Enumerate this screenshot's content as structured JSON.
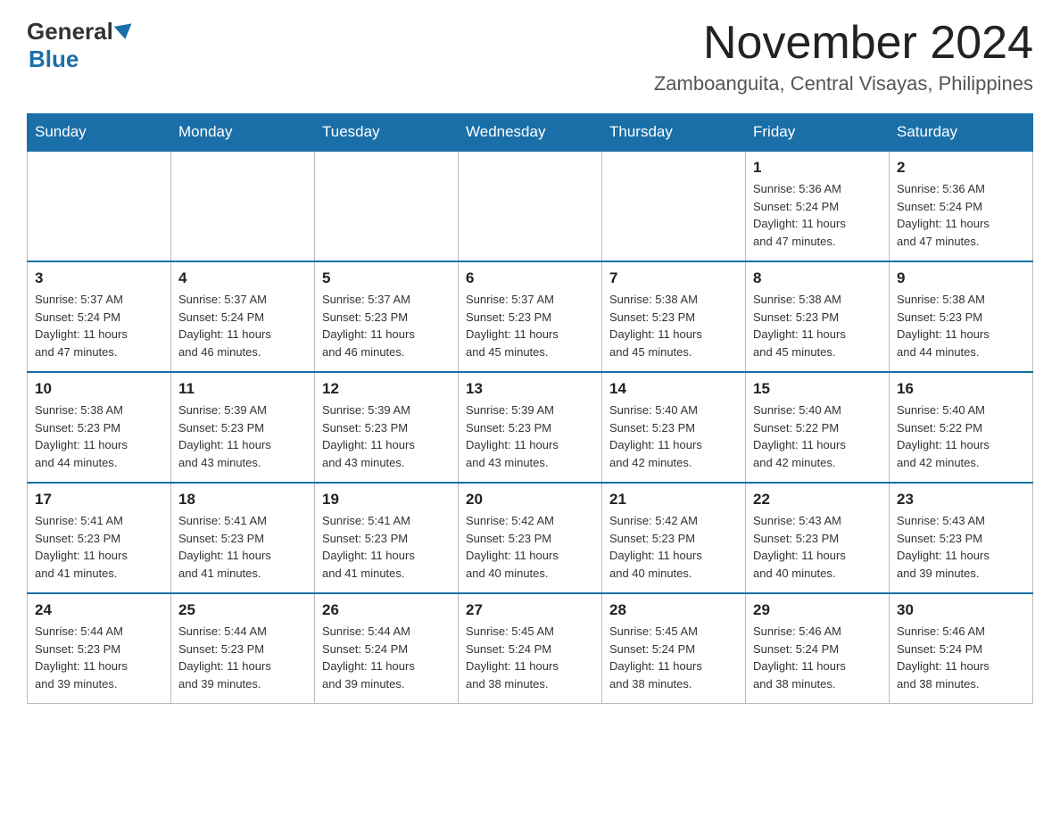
{
  "header": {
    "logo_general": "General",
    "logo_blue": "Blue",
    "month_title": "November 2024",
    "location": "Zamboanguita, Central Visayas, Philippines"
  },
  "days_of_week": [
    "Sunday",
    "Monday",
    "Tuesday",
    "Wednesday",
    "Thursday",
    "Friday",
    "Saturday"
  ],
  "weeks": [
    [
      {
        "day": "",
        "info": ""
      },
      {
        "day": "",
        "info": ""
      },
      {
        "day": "",
        "info": ""
      },
      {
        "day": "",
        "info": ""
      },
      {
        "day": "",
        "info": ""
      },
      {
        "day": "1",
        "info": "Sunrise: 5:36 AM\nSunset: 5:24 PM\nDaylight: 11 hours\nand 47 minutes."
      },
      {
        "day": "2",
        "info": "Sunrise: 5:36 AM\nSunset: 5:24 PM\nDaylight: 11 hours\nand 47 minutes."
      }
    ],
    [
      {
        "day": "3",
        "info": "Sunrise: 5:37 AM\nSunset: 5:24 PM\nDaylight: 11 hours\nand 47 minutes."
      },
      {
        "day": "4",
        "info": "Sunrise: 5:37 AM\nSunset: 5:24 PM\nDaylight: 11 hours\nand 46 minutes."
      },
      {
        "day": "5",
        "info": "Sunrise: 5:37 AM\nSunset: 5:23 PM\nDaylight: 11 hours\nand 46 minutes."
      },
      {
        "day": "6",
        "info": "Sunrise: 5:37 AM\nSunset: 5:23 PM\nDaylight: 11 hours\nand 45 minutes."
      },
      {
        "day": "7",
        "info": "Sunrise: 5:38 AM\nSunset: 5:23 PM\nDaylight: 11 hours\nand 45 minutes."
      },
      {
        "day": "8",
        "info": "Sunrise: 5:38 AM\nSunset: 5:23 PM\nDaylight: 11 hours\nand 45 minutes."
      },
      {
        "day": "9",
        "info": "Sunrise: 5:38 AM\nSunset: 5:23 PM\nDaylight: 11 hours\nand 44 minutes."
      }
    ],
    [
      {
        "day": "10",
        "info": "Sunrise: 5:38 AM\nSunset: 5:23 PM\nDaylight: 11 hours\nand 44 minutes."
      },
      {
        "day": "11",
        "info": "Sunrise: 5:39 AM\nSunset: 5:23 PM\nDaylight: 11 hours\nand 43 minutes."
      },
      {
        "day": "12",
        "info": "Sunrise: 5:39 AM\nSunset: 5:23 PM\nDaylight: 11 hours\nand 43 minutes."
      },
      {
        "day": "13",
        "info": "Sunrise: 5:39 AM\nSunset: 5:23 PM\nDaylight: 11 hours\nand 43 minutes."
      },
      {
        "day": "14",
        "info": "Sunrise: 5:40 AM\nSunset: 5:23 PM\nDaylight: 11 hours\nand 42 minutes."
      },
      {
        "day": "15",
        "info": "Sunrise: 5:40 AM\nSunset: 5:22 PM\nDaylight: 11 hours\nand 42 minutes."
      },
      {
        "day": "16",
        "info": "Sunrise: 5:40 AM\nSunset: 5:22 PM\nDaylight: 11 hours\nand 42 minutes."
      }
    ],
    [
      {
        "day": "17",
        "info": "Sunrise: 5:41 AM\nSunset: 5:23 PM\nDaylight: 11 hours\nand 41 minutes."
      },
      {
        "day": "18",
        "info": "Sunrise: 5:41 AM\nSunset: 5:23 PM\nDaylight: 11 hours\nand 41 minutes."
      },
      {
        "day": "19",
        "info": "Sunrise: 5:41 AM\nSunset: 5:23 PM\nDaylight: 11 hours\nand 41 minutes."
      },
      {
        "day": "20",
        "info": "Sunrise: 5:42 AM\nSunset: 5:23 PM\nDaylight: 11 hours\nand 40 minutes."
      },
      {
        "day": "21",
        "info": "Sunrise: 5:42 AM\nSunset: 5:23 PM\nDaylight: 11 hours\nand 40 minutes."
      },
      {
        "day": "22",
        "info": "Sunrise: 5:43 AM\nSunset: 5:23 PM\nDaylight: 11 hours\nand 40 minutes."
      },
      {
        "day": "23",
        "info": "Sunrise: 5:43 AM\nSunset: 5:23 PM\nDaylight: 11 hours\nand 39 minutes."
      }
    ],
    [
      {
        "day": "24",
        "info": "Sunrise: 5:44 AM\nSunset: 5:23 PM\nDaylight: 11 hours\nand 39 minutes."
      },
      {
        "day": "25",
        "info": "Sunrise: 5:44 AM\nSunset: 5:23 PM\nDaylight: 11 hours\nand 39 minutes."
      },
      {
        "day": "26",
        "info": "Sunrise: 5:44 AM\nSunset: 5:24 PM\nDaylight: 11 hours\nand 39 minutes."
      },
      {
        "day": "27",
        "info": "Sunrise: 5:45 AM\nSunset: 5:24 PM\nDaylight: 11 hours\nand 38 minutes."
      },
      {
        "day": "28",
        "info": "Sunrise: 5:45 AM\nSunset: 5:24 PM\nDaylight: 11 hours\nand 38 minutes."
      },
      {
        "day": "29",
        "info": "Sunrise: 5:46 AM\nSunset: 5:24 PM\nDaylight: 11 hours\nand 38 minutes."
      },
      {
        "day": "30",
        "info": "Sunrise: 5:46 AM\nSunset: 5:24 PM\nDaylight: 11 hours\nand 38 minutes."
      }
    ]
  ]
}
